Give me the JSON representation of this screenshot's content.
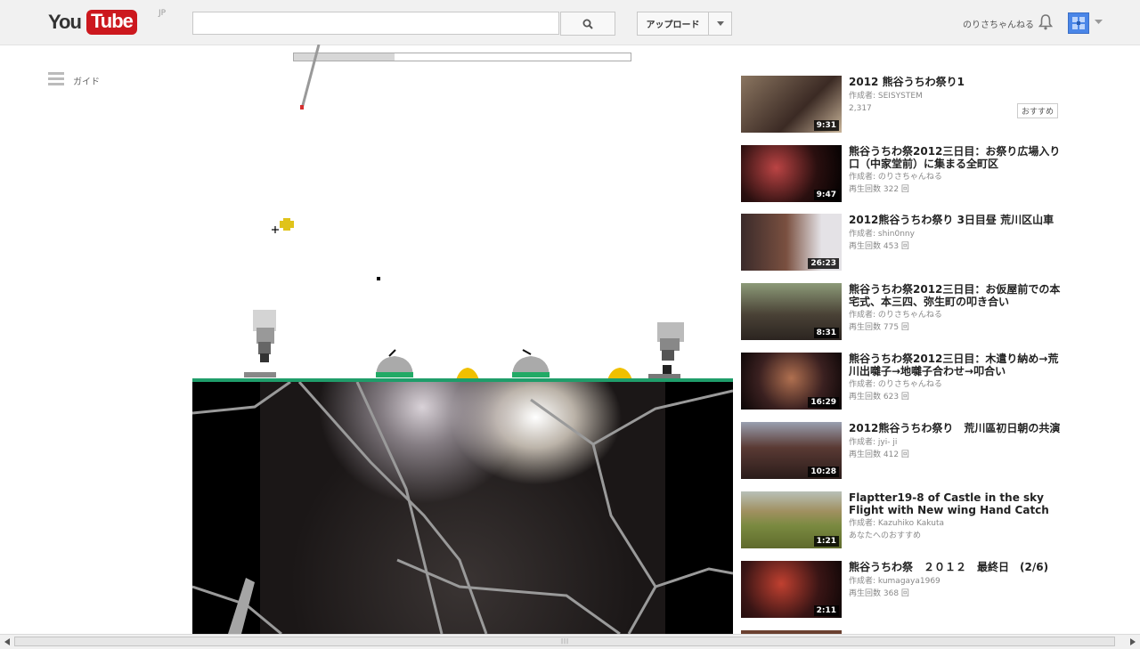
{
  "header": {
    "logo_you": "You",
    "logo_tube": "Tube",
    "logo_region": "JP",
    "search_placeholder": "",
    "upload_label": "アップロード",
    "username": "のりさちゃんねる",
    "icons": [
      "search-icon",
      "chevron-down-icon",
      "bell-icon",
      "avatar"
    ]
  },
  "guide": {
    "label": "ガイド"
  },
  "game": {
    "progress": 0.3,
    "ground_color": "#1f9d6a"
  },
  "sidebar": {
    "items": [
      {
        "title": "2012 熊谷うちわ祭り1",
        "author": "作成者: SEISYSTEM",
        "stat": "2,317",
        "duration": "9:31",
        "badge": "おすすめ"
      },
      {
        "title": "熊谷うちわ祭2012三日目：お祭り広場入り口（中家堂前）に集まる全町区",
        "author": "作成者: のりさちゃんねる",
        "stat": "再生回数 322 回",
        "duration": "9:47"
      },
      {
        "title": "2012熊谷うちわ祭り 3日目昼 荒川区山車",
        "author": "作成者: shin0nny",
        "stat": "再生回数 453 回",
        "duration": "26:23"
      },
      {
        "title": "熊谷うちわ祭2012三日目：お仮屋前での本宅式、本三四、弥生町の叩き合い",
        "author": "作成者: のりさちゃんねる",
        "stat": "再生回数 775 回",
        "duration": "8:31"
      },
      {
        "title": "熊谷うちわ祭2012三日目：木遣り納め→荒川出囃子→地囃子合わせ→叩合い",
        "author": "作成者: のりさちゃんねる",
        "stat": "再生回数 623 回",
        "duration": "16:29"
      },
      {
        "title": "2012熊谷うちわ祭り　荒川區初日朝の共演",
        "author": "作成者: jyi- ji",
        "stat": "再生回数 412 回",
        "duration": "10:28"
      },
      {
        "title": "Flaptter19-8 of Castle in the sky Flight with New wing  Hand Catch",
        "author": "作成者: Kazuhiko Kakuta",
        "stat": "あなたへのおすすめ",
        "duration": "1:21"
      },
      {
        "title": "熊谷うちわ祭　２０１２　最終日　(2/6)",
        "author": "作成者: kumagaya1969",
        "stat": "再生回数 368 回",
        "duration": "2:11"
      }
    ]
  },
  "colors": {
    "accent": "#cc181e",
    "avatar": "#4a86e8"
  }
}
